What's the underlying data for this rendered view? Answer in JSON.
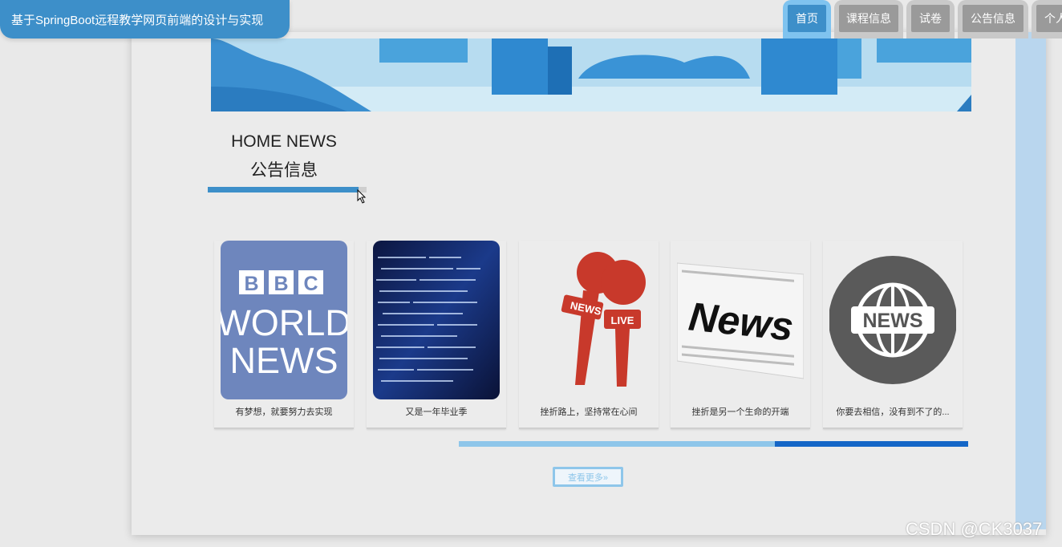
{
  "header": {
    "title": "基于SpringBoot远程教学网页前端的设计与实现",
    "nav": [
      {
        "label": "首页",
        "active": true
      },
      {
        "label": "课程信息",
        "active": false
      },
      {
        "label": "试卷",
        "active": false
      },
      {
        "label": "公告信息",
        "active": false
      },
      {
        "label": "个人",
        "active": false
      }
    ]
  },
  "section": {
    "title_en": "HOME NEWS",
    "title_cn": "公告信息"
  },
  "cards": [
    {
      "caption": "有梦想，就要努力去实现",
      "image": "bbc-world-news",
      "thumb_text": [
        "BBC",
        "WORLD",
        "NEWS"
      ]
    },
    {
      "caption": "又是一年毕业季",
      "image": "code-screen"
    },
    {
      "caption": "挫折路上，坚持常在心间",
      "image": "news-live-microphones",
      "thumb_text": [
        "NEWS",
        "LIVE"
      ]
    },
    {
      "caption": "挫折是另一个生命的开端",
      "image": "newspaper",
      "thumb_text": [
        "News"
      ]
    },
    {
      "caption": "你要去相信，没有到不了的...",
      "image": "news-globe",
      "thumb_text": [
        "NEWS"
      ]
    }
  ],
  "carousel": {
    "position": 0.62
  },
  "more_button": {
    "label": "查看更多»"
  },
  "watermark": "CSDN @CK3037",
  "colors": {
    "primary": "#3d8fc9",
    "accent_light": "#8ec6ea",
    "progress": "#1466c7"
  }
}
